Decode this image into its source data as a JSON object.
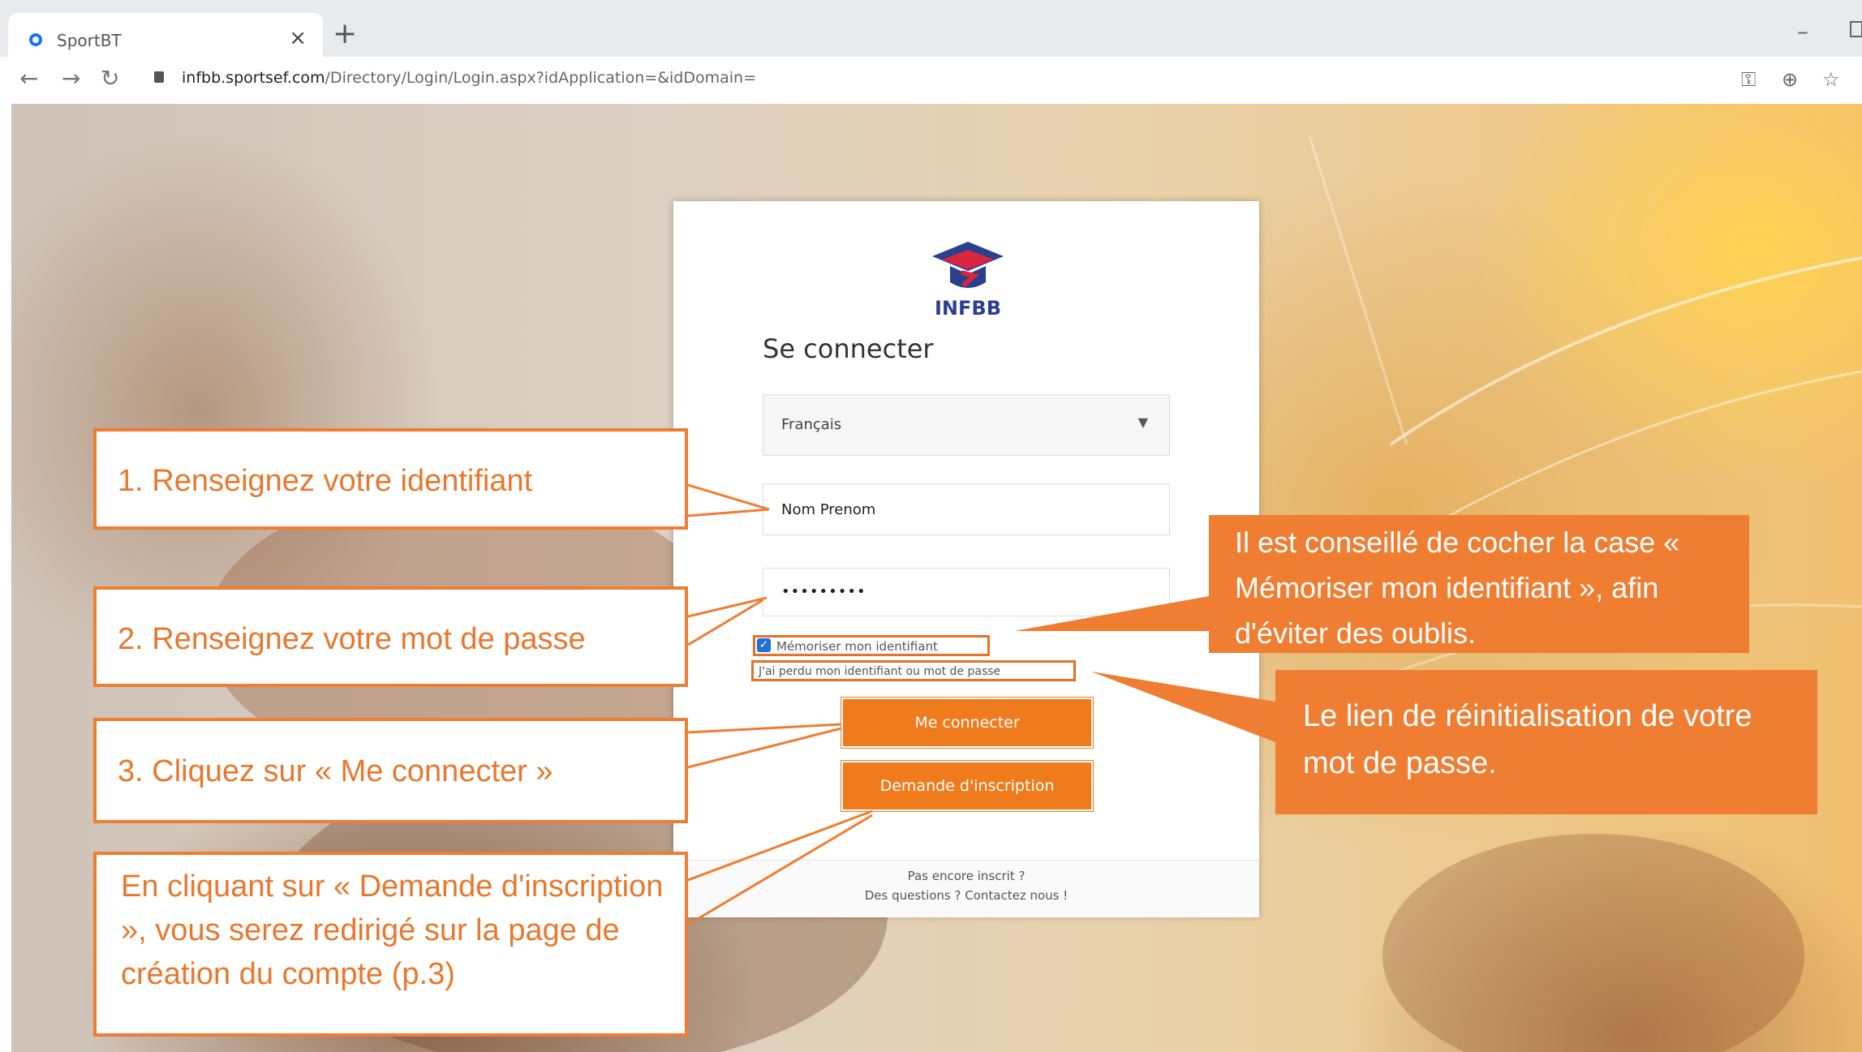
{
  "browser": {
    "tab_title": "SportBT",
    "tab_close": "×",
    "new_tab": "+",
    "url_domain": "infbb.sportsef.com",
    "url_path": "/Directory/Login/Login.aspx?idApplication=&idDomain=",
    "window_minimize": "–"
  },
  "login": {
    "logo_text": "INFBB",
    "title": "Se connecter",
    "language_value": "Français",
    "username_value": "Nom Prenom",
    "password_value": "•••••••••",
    "remember_label": "Mémoriser mon identifiant",
    "forgot_label": "J'ai perdu mon identifiant ou mot de passe",
    "connect_button": "Me connecter",
    "register_button": "Demande d'inscription",
    "footer_line1": "Pas encore inscrit ?",
    "footer_line2": "Des questions ? Contactez nous !"
  },
  "callouts": {
    "step1": "1. Renseignez votre identifiant",
    "step2": "2. Renseignez votre mot de passe",
    "step3": "3. Cliquez sur « Me connecter »",
    "register_note": "En cliquant sur « Demande d'inscription », vous serez redirigé sur la page de création du compte (p.3)",
    "remember_note": "Il est conseillé de cocher la case « Mémoriser mon identifiant », afin d'éviter des oublis.",
    "reset_note": "Le lien de réinitialisation de votre mot de passe."
  },
  "colors": {
    "accent": "#ef7d32",
    "button": "#f07b1c",
    "logo_blue": "#2b3f8f",
    "logo_red": "#d7263d"
  }
}
